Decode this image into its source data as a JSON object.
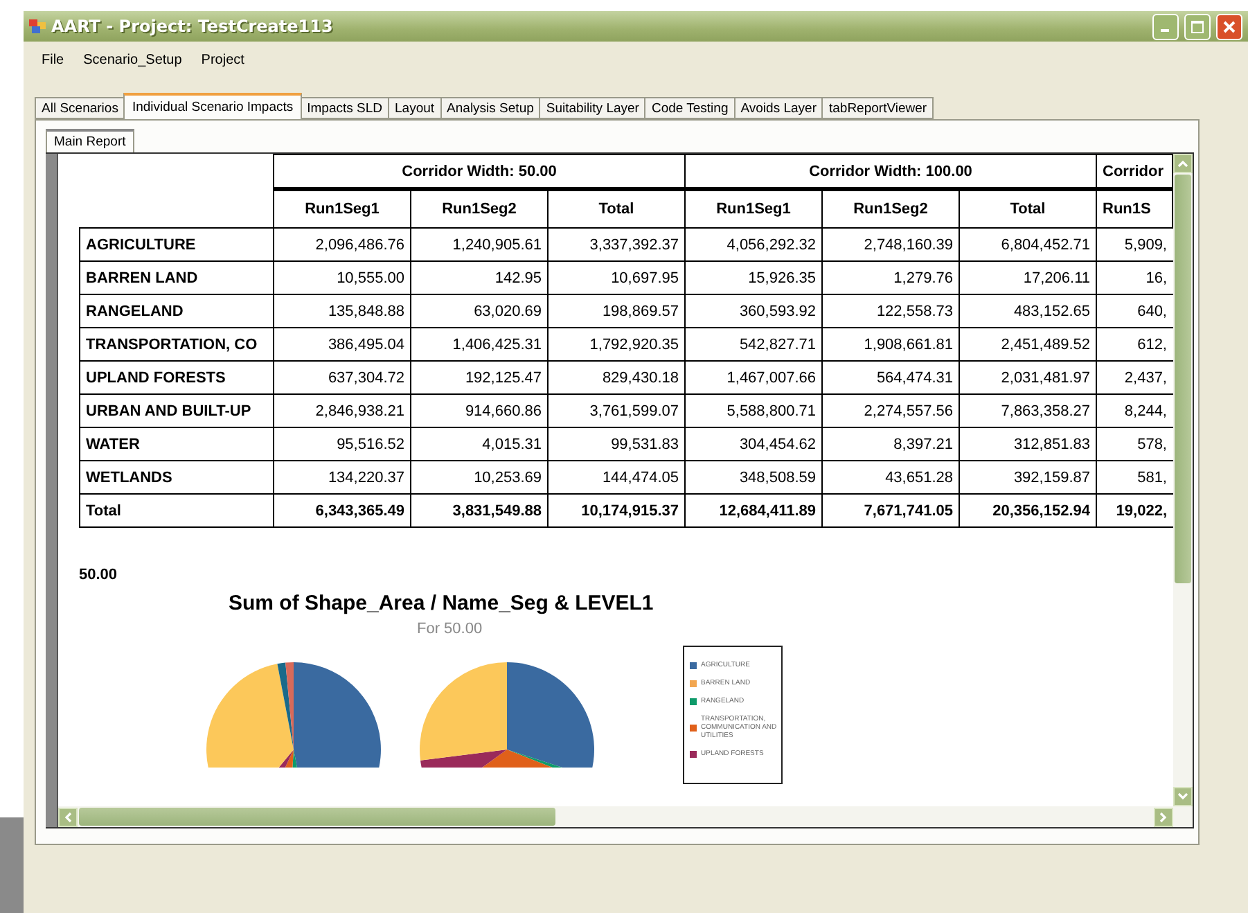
{
  "window": {
    "title": "AART - Project: TestCreate113"
  },
  "menu": [
    "File",
    "Scenario_Setup",
    "Project"
  ],
  "tabs": [
    {
      "label": "All Scenarios",
      "selected": false
    },
    {
      "label": "Individual Scenario Impacts",
      "selected": true
    },
    {
      "label": "Impacts SLD",
      "selected": false
    },
    {
      "label": "Layout",
      "selected": false
    },
    {
      "label": "Analysis Setup",
      "selected": false
    },
    {
      "label": "Suitability Layer",
      "selected": false
    },
    {
      "label": "Code Testing",
      "selected": false
    },
    {
      "label": "Avoids Layer",
      "selected": false
    },
    {
      "label": "tabReportViewer",
      "selected": false
    }
  ],
  "report_tabs": [
    {
      "label": "Main Report",
      "selected": true
    }
  ],
  "table": {
    "column_groups": [
      "Corridor Width: 50.00",
      "Corridor Width: 100.00",
      "Corridor"
    ],
    "columns": [
      "Run1Seg1",
      "Run1Seg2",
      "Total",
      "Run1Seg1",
      "Run1Seg2",
      "Total",
      "Run1S"
    ],
    "rows": [
      {
        "label": "AGRICULTURE",
        "cells": [
          "2,096,486.76",
          "1,240,905.61",
          "3,337,392.37",
          "4,056,292.32",
          "2,748,160.39",
          "6,804,452.71",
          "5,909,"
        ]
      },
      {
        "label": "BARREN LAND",
        "cells": [
          "10,555.00",
          "142.95",
          "10,697.95",
          "15,926.35",
          "1,279.76",
          "17,206.11",
          "16,"
        ]
      },
      {
        "label": "RANGELAND",
        "cells": [
          "135,848.88",
          "63,020.69",
          "198,869.57",
          "360,593.92",
          "122,558.73",
          "483,152.65",
          "640,"
        ]
      },
      {
        "label": "TRANSPORTATION, CO",
        "cells": [
          "386,495.04",
          "1,406,425.31",
          "1,792,920.35",
          "542,827.71",
          "1,908,661.81",
          "2,451,489.52",
          "612,"
        ]
      },
      {
        "label": "UPLAND FORESTS",
        "cells": [
          "637,304.72",
          "192,125.47",
          "829,430.18",
          "1,467,007.66",
          "564,474.31",
          "2,031,481.97",
          "2,437,"
        ]
      },
      {
        "label": "URBAN AND BUILT-UP",
        "cells": [
          "2,846,938.21",
          "914,660.86",
          "3,761,599.07",
          "5,588,800.71",
          "2,274,557.56",
          "7,863,358.27",
          "8,244,"
        ]
      },
      {
        "label": "WATER",
        "cells": [
          "95,516.52",
          "4,015.31",
          "99,531.83",
          "304,454.62",
          "8,397.21",
          "312,851.83",
          "578,"
        ]
      },
      {
        "label": "WETLANDS",
        "cells": [
          "134,220.37",
          "10,253.69",
          "144,474.05",
          "348,508.59",
          "43,651.28",
          "392,159.87",
          "581,"
        ]
      }
    ],
    "total_row": {
      "label": "Total",
      "cells": [
        "6,343,365.49",
        "3,831,549.88",
        "10,174,915.37",
        "12,684,411.89",
        "7,671,741.05",
        "20,356,152.94",
        "19,022,"
      ]
    }
  },
  "chart_section": {
    "heading": "50.00",
    "title": "Sum of Shape_Area / Name_Seg & LEVEL1",
    "subtitle": "For 50.00",
    "legend": [
      {
        "label": "AGRICULTURE",
        "color": "#3a6aa0"
      },
      {
        "label": "BARREN LAND",
        "color": "#f2a650"
      },
      {
        "label": "RANGELAND",
        "color": "#0e9a6a"
      },
      {
        "label": "TRANSPORTATION, COMMUNICATION AND UTILITIES",
        "color": "#e0601a"
      },
      {
        "label": "UPLAND FORESTS",
        "color": "#9a2a5a"
      }
    ]
  }
}
